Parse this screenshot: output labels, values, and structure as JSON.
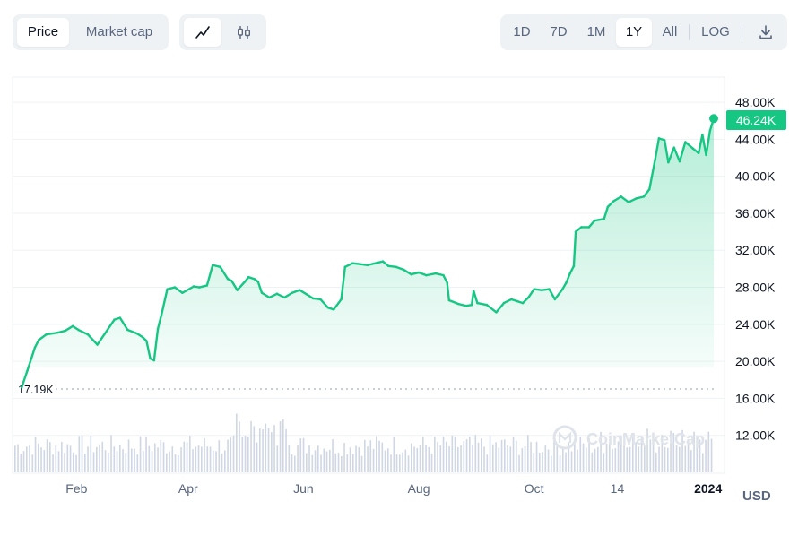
{
  "toolbar": {
    "metric_tabs": [
      {
        "label": "Price",
        "active": true
      },
      {
        "label": "Market cap",
        "active": false
      }
    ],
    "chart_type_icons": [
      {
        "icon": "line-chart-icon",
        "active": true
      },
      {
        "icon": "candlestick-icon",
        "active": false
      }
    ],
    "range_tabs": [
      {
        "label": "1D",
        "active": false
      },
      {
        "label": "7D",
        "active": false
      },
      {
        "label": "1M",
        "active": false
      },
      {
        "label": "1Y",
        "active": true
      },
      {
        "label": "All",
        "active": false
      }
    ],
    "log_label": "LOG",
    "download_icon": "download-icon"
  },
  "currency_label": "USD",
  "watermark": "CoinMarketCap",
  "colors": {
    "line": "#16c784",
    "price_badge": "#16c784",
    "baseline": "#a6b0c3",
    "volume": "#cfd6e4",
    "grid": "#eff2f5",
    "text": "#58667e"
  },
  "chart_data": {
    "type": "area",
    "title": "",
    "xlabel": "",
    "ylabel": "",
    "ylim": [
      8000,
      50000
    ],
    "y_ticks": [
      12000,
      16000,
      20000,
      24000,
      28000,
      32000,
      36000,
      40000,
      44000,
      48000
    ],
    "y_tick_labels": [
      "12.00K",
      "16.00K",
      "20.00K",
      "24.00K",
      "28.00K",
      "32.00K",
      "36.00K",
      "40.00K",
      "44.00K",
      "48.00K"
    ],
    "x_range": [
      "2023-01-01",
      "2024-01-04"
    ],
    "x_ticks": [
      {
        "date": "2023-02-01",
        "label": "Feb",
        "bold": false
      },
      {
        "date": "2023-04-01",
        "label": "Apr",
        "bold": false
      },
      {
        "date": "2023-06-01",
        "label": "Jun",
        "bold": false
      },
      {
        "date": "2023-08-01",
        "label": "Aug",
        "bold": false
      },
      {
        "date": "2023-10-01",
        "label": "Oct",
        "bold": false
      },
      {
        "date": "2023-11-14",
        "label": "14",
        "bold": false
      },
      {
        "date": "2024-01-01",
        "label": "2024",
        "bold": true
      }
    ],
    "current_price": 46240,
    "current_price_label": "46.24K",
    "baseline_price": 17190,
    "baseline_label": "17.19K",
    "series": [
      {
        "points": [
          [
            "2023-01-03",
            17190
          ],
          [
            "2023-01-06",
            19000
          ],
          [
            "2023-01-10",
            21500
          ],
          [
            "2023-01-12",
            22300
          ],
          [
            "2023-01-16",
            22900
          ],
          [
            "2023-01-22",
            23100
          ],
          [
            "2023-01-26",
            23300
          ],
          [
            "2023-01-30",
            23800
          ],
          [
            "2023-02-02",
            23400
          ],
          [
            "2023-02-07",
            22900
          ],
          [
            "2023-02-12",
            21800
          ],
          [
            "2023-02-16",
            23000
          ],
          [
            "2023-02-21",
            24500
          ],
          [
            "2023-02-24",
            24700
          ],
          [
            "2023-02-28",
            23400
          ],
          [
            "2023-03-05",
            23000
          ],
          [
            "2023-03-08",
            22600
          ],
          [
            "2023-03-10",
            22200
          ],
          [
            "2023-03-12",
            20300
          ],
          [
            "2023-03-14",
            20100
          ],
          [
            "2023-03-16",
            23500
          ],
          [
            "2023-03-18",
            25100
          ],
          [
            "2023-03-21",
            27800
          ],
          [
            "2023-03-25",
            28000
          ],
          [
            "2023-03-29",
            27400
          ],
          [
            "2023-04-04",
            28100
          ],
          [
            "2023-04-07",
            28000
          ],
          [
            "2023-04-11",
            28200
          ],
          [
            "2023-04-14",
            30400
          ],
          [
            "2023-04-18",
            30200
          ],
          [
            "2023-04-22",
            28900
          ],
          [
            "2023-04-24",
            28700
          ],
          [
            "2023-04-27",
            27700
          ],
          [
            "2023-05-01",
            28600
          ],
          [
            "2023-05-03",
            29100
          ],
          [
            "2023-05-06",
            28900
          ],
          [
            "2023-05-08",
            28600
          ],
          [
            "2023-05-10",
            27400
          ],
          [
            "2023-05-14",
            26900
          ],
          [
            "2023-05-18",
            27300
          ],
          [
            "2023-05-22",
            26900
          ],
          [
            "2023-05-26",
            27400
          ],
          [
            "2023-05-30",
            27700
          ],
          [
            "2023-06-03",
            27200
          ],
          [
            "2023-06-06",
            26800
          ],
          [
            "2023-06-10",
            26700
          ],
          [
            "2023-06-14",
            25800
          ],
          [
            "2023-06-17",
            25600
          ],
          [
            "2023-06-21",
            26700
          ],
          [
            "2023-06-23",
            30200
          ],
          [
            "2023-06-27",
            30600
          ],
          [
            "2023-07-01",
            30500
          ],
          [
            "2023-07-05",
            30400
          ],
          [
            "2023-07-09",
            30600
          ],
          [
            "2023-07-13",
            30800
          ],
          [
            "2023-07-16",
            30300
          ],
          [
            "2023-07-20",
            30200
          ],
          [
            "2023-07-24",
            29900
          ],
          [
            "2023-07-28",
            29400
          ],
          [
            "2023-08-01",
            29600
          ],
          [
            "2023-08-05",
            29300
          ],
          [
            "2023-08-10",
            29500
          ],
          [
            "2023-08-14",
            29300
          ],
          [
            "2023-08-16",
            28500
          ],
          [
            "2023-08-17",
            26600
          ],
          [
            "2023-08-22",
            26200
          ],
          [
            "2023-08-26",
            26000
          ],
          [
            "2023-08-29",
            26100
          ],
          [
            "2023-08-30",
            27600
          ],
          [
            "2023-09-01",
            26300
          ],
          [
            "2023-09-06",
            26100
          ],
          [
            "2023-09-11",
            25300
          ],
          [
            "2023-09-15",
            26300
          ],
          [
            "2023-09-19",
            26700
          ],
          [
            "2023-09-22",
            26500
          ],
          [
            "2023-09-25",
            26300
          ],
          [
            "2023-09-28",
            26900
          ],
          [
            "2023-10-01",
            27800
          ],
          [
            "2023-10-05",
            27700
          ],
          [
            "2023-10-09",
            27800
          ],
          [
            "2023-10-12",
            26700
          ],
          [
            "2023-10-16",
            27800
          ],
          [
            "2023-10-18",
            28500
          ],
          [
            "2023-10-20",
            29500
          ],
          [
            "2023-10-22",
            30300
          ],
          [
            "2023-10-23",
            34000
          ],
          [
            "2023-10-26",
            34500
          ],
          [
            "2023-10-30",
            34500
          ],
          [
            "2023-11-02",
            35200
          ],
          [
            "2023-11-07",
            35400
          ],
          [
            "2023-11-09",
            36700
          ],
          [
            "2023-11-12",
            37300
          ],
          [
            "2023-11-16",
            37800
          ],
          [
            "2023-11-20",
            37200
          ],
          [
            "2023-11-24",
            37600
          ],
          [
            "2023-11-28",
            37800
          ],
          [
            "2023-12-01",
            38600
          ],
          [
            "2023-12-04",
            41800
          ],
          [
            "2023-12-06",
            44100
          ],
          [
            "2023-12-09",
            43900
          ],
          [
            "2023-12-11",
            41500
          ],
          [
            "2023-12-14",
            43100
          ],
          [
            "2023-12-17",
            41600
          ],
          [
            "2023-12-20",
            43700
          ],
          [
            "2023-12-24",
            43000
          ],
          [
            "2023-12-27",
            42500
          ],
          [
            "2023-12-29",
            44500
          ],
          [
            "2023-12-31",
            42300
          ],
          [
            "2024-01-02",
            44900
          ],
          [
            "2024-01-04",
            46240
          ]
        ]
      }
    ],
    "volume_bars": 240
  }
}
